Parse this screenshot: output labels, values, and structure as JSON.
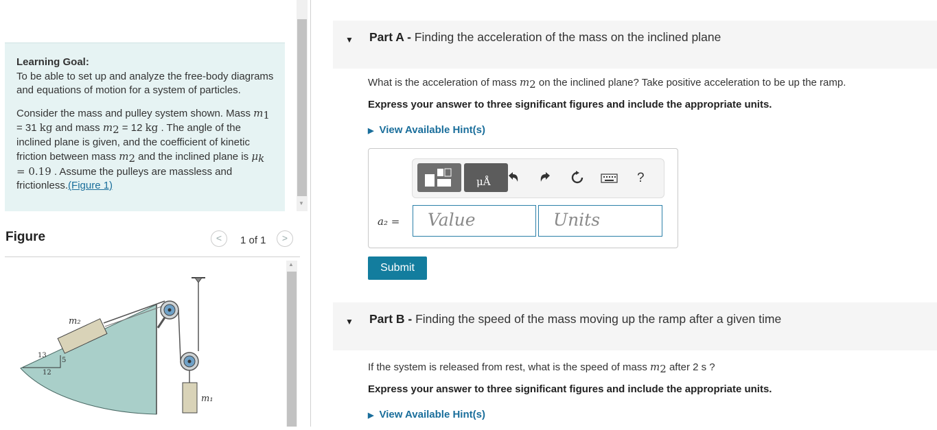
{
  "goal": {
    "heading": "Learning Goal:",
    "intro": "To be able to set up and analyze the free-body diagrams and equations of motion for a system of particles.",
    "p2_a": "Consider the mass and pulley system shown. Mass ",
    "m1_sym": "m",
    "m1_sub": "1",
    "p2_b": " = 31 ",
    "unit_kg_1": "kg",
    "p2_c": " and mass ",
    "m2_sym": "m",
    "m2_sub": "2",
    "p2_d": " = 12 ",
    "unit_kg_2": "kg",
    "p2_e": " . The angle of the inclined plane is given, and the coefficient of kinetic friction between mass ",
    "m2b_sym": "m",
    "m2b_sub": "2",
    "p2_f": " and the inclined plane is ",
    "mu_sym": "μ",
    "mu_sub": "k",
    "mu_val": " = 0.19",
    "p2_g": " . Assume the pulleys are massless and frictionless.",
    "fig_link": "(Figure 1)"
  },
  "figure": {
    "title": "Figure",
    "pager": "1 of 1",
    "prev_glyph": "<",
    "next_glyph": ">",
    "label_m2": "m₂",
    "label_m1": "m₁",
    "tri_13": "13",
    "tri_5": "5",
    "tri_12": "12"
  },
  "partA": {
    "label": "Part A - ",
    "title": "Finding the acceleration of  the mass on the inclined plane",
    "q_a": "What is the acceleration of mass ",
    "q_sym": "m",
    "q_sub": "2",
    "q_b": " on the inclined plane? Take positive acceleration to be up the ramp.",
    "instruction": "Express your answer to three significant figures and include the appropriate units.",
    "hint": "View Available Hint(s)",
    "answer_label": "a₂ =",
    "value_placeholder": "Value",
    "units_placeholder": "Units",
    "unit_btn_text": "μÅ",
    "help": "?",
    "submit": "Submit"
  },
  "partB": {
    "label": "Part B - ",
    "title": "Finding the speed of the mass moving up the ramp after a given time",
    "q_a": "If the system is released from rest, what is the speed of mass ",
    "q_sym": "m",
    "q_sub": "2",
    "q_b": " after 2  s ?",
    "instruction": "Express your answer to three significant figures and include the appropriate units.",
    "hint": "View Available Hint(s)"
  },
  "icons": {
    "collapse": "triangle-down-icon",
    "hint_caret": "triangle-right-icon",
    "undo": "undo-icon",
    "redo": "redo-icon",
    "reset": "reset-icon",
    "keyboard": "keyboard-icon"
  },
  "colors": {
    "goal_bg": "#e6f3f3",
    "link": "#1a6e9b",
    "submit_bg": "#137d9e",
    "input_border": "#2a7fa8",
    "incline_fill": "#a9cfc9"
  }
}
